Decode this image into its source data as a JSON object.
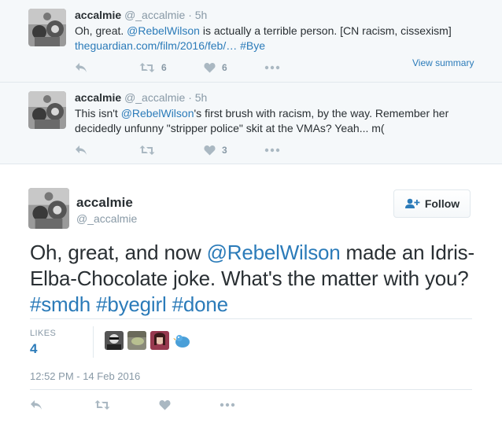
{
  "replies": [
    {
      "name": "accalmie",
      "handle": "@_accalmie",
      "dot": "·",
      "time": "5h",
      "text_parts": [
        "Oh, great. ",
        "@RebelWilson",
        " is actually a terrible person. [CN racism, cissexism]"
      ],
      "link_line": [
        "theguardian.com/film/2016/feb/…",
        " ",
        "#Bye"
      ],
      "retweets": "6",
      "likes": "6",
      "view_summary": "View summary"
    },
    {
      "name": "accalmie",
      "handle": "@_accalmie",
      "dot": "·",
      "time": "5h",
      "text_parts": [
        "This isn't ",
        "@RebelWilson",
        "'s first brush with racism, by the way. Remember her"
      ],
      "line2": "decidedly unfunny \"stripper police\" skit at the VMAs? Yeah... m(",
      "retweets": "",
      "likes": "3"
    }
  ],
  "main": {
    "name": "accalmie",
    "handle": "@_accalmie",
    "follow_label": "Follow",
    "text_parts": [
      "Oh, great, and now ",
      "@RebelWilson",
      " made an Idris-Elba-Chocolate joke. What's the matter with you? ",
      "#smdh",
      " ",
      "#byegirl",
      " ",
      "#done"
    ],
    "likes_label": "LIKES",
    "likes_count": "4",
    "timestamp": "12:52 PM - 14 Feb 2016"
  },
  "icons": {
    "reply": "reply-icon",
    "retweet": "retweet-icon",
    "like": "heart-icon",
    "more": "more-icon",
    "follow": "add-user-icon"
  },
  "colors": {
    "link": "#2b7bb9",
    "muted": "#8899a6",
    "icon": "#aab8c2",
    "reply_bg": "#f5f8fa"
  }
}
